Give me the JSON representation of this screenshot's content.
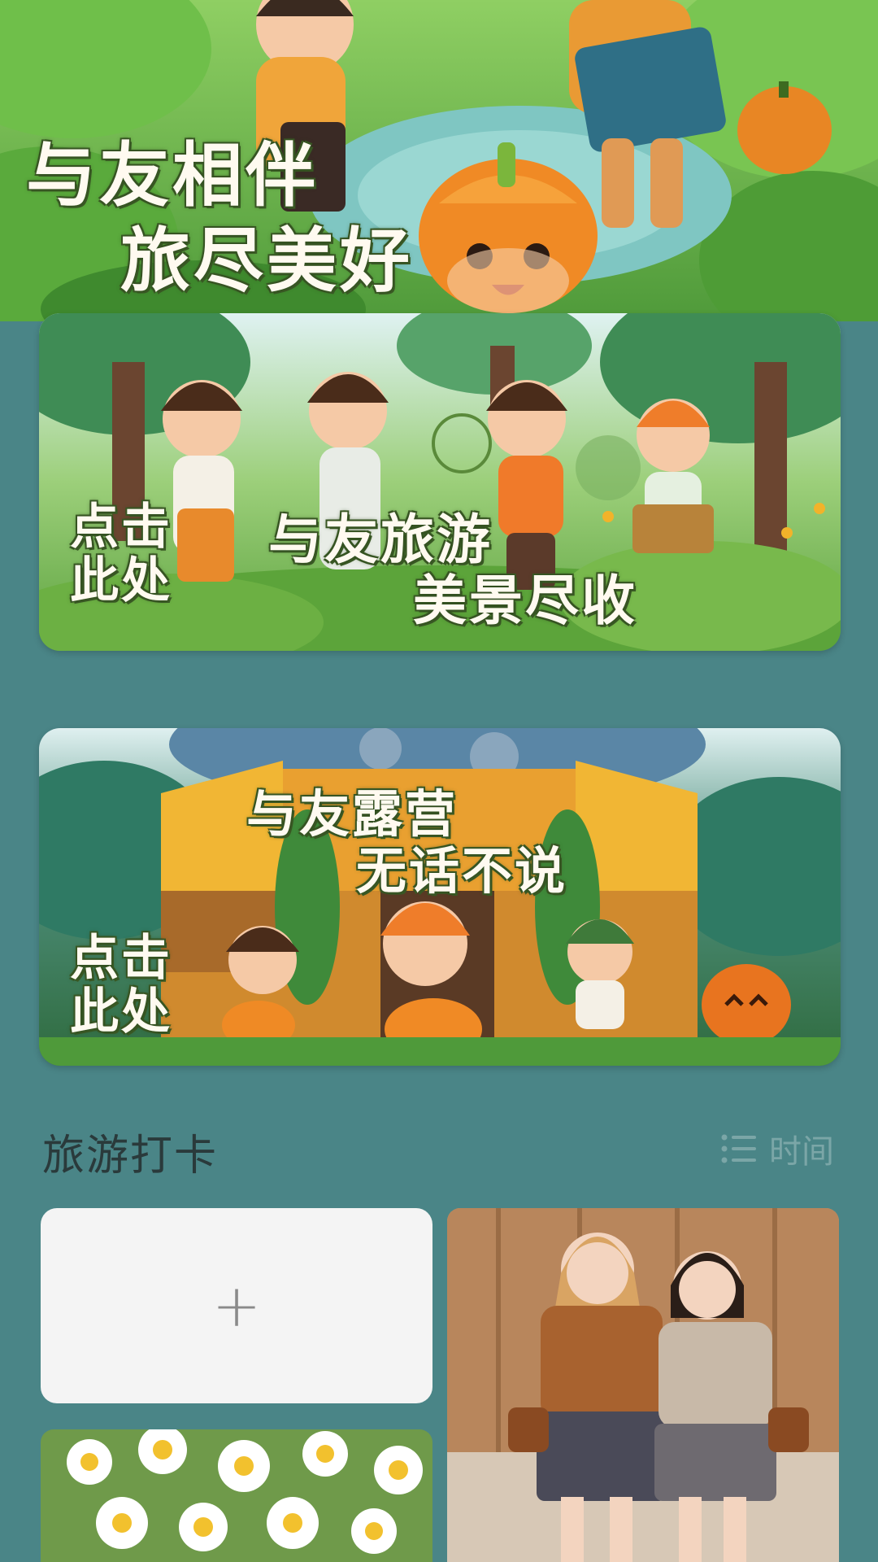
{
  "hero": {
    "line1": "与友相伴",
    "line2": "旅尽美好"
  },
  "banners": [
    {
      "click_label": "点击此处",
      "line1": "与友旅游",
      "line2": "美景尽收"
    },
    {
      "click_label": "点击此处",
      "line1": "与友露营",
      "line2": "无话不说"
    }
  ],
  "section": {
    "title": "旅游打卡",
    "sort_label": "时间",
    "sort_icon": "list-icon"
  },
  "grid": {
    "add_label": "+"
  },
  "colors": {
    "background": "#4a8587",
    "card": "#f4f4f4",
    "title_text": "#2a3a3b",
    "sort_text": "#7ba6a7"
  }
}
